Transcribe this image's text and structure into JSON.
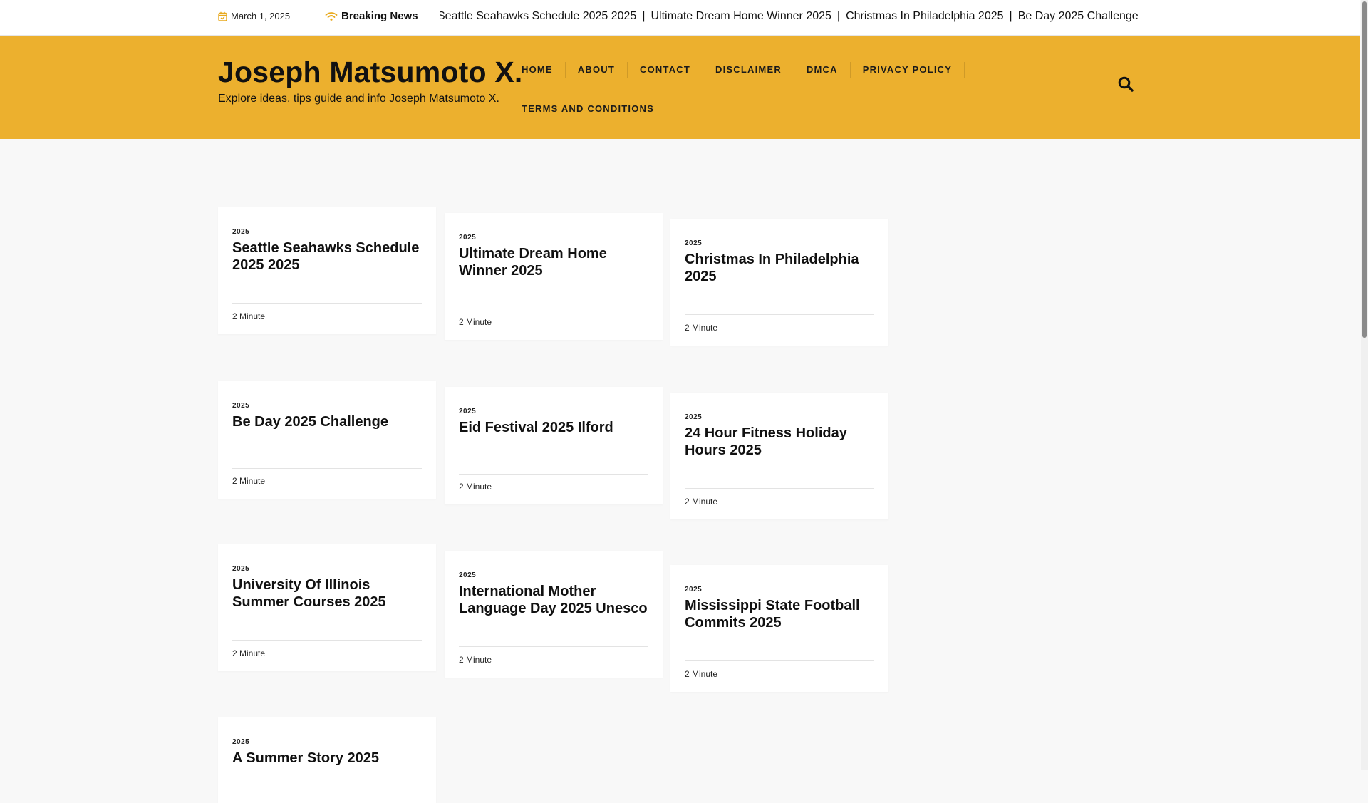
{
  "topbar": {
    "date": "March 1, 2025",
    "breaking_label": "Breaking News",
    "ticker": [
      "Seattle Seahawks Schedule 2025 2025",
      "Ultimate Dream Home Winner 2025",
      "Christmas In Philadelphia 2025",
      "Be Day 2025 Challenge",
      "Eid Festival 2025 Ilford"
    ],
    "ticker_separator": "|"
  },
  "header": {
    "site_title": "Joseph Matsumoto X.",
    "tagline": "Explore ideas, tips guide and info Joseph Matsumoto X."
  },
  "nav": {
    "items": [
      "HOME",
      "ABOUT",
      "CONTACT",
      "DISCLAIMER",
      "DMCA",
      "PRIVACY POLICY",
      "TERMS AND CONDITIONS"
    ]
  },
  "posts": [
    {
      "category": "2025",
      "title": "Seattle Seahawks Schedule 2025 2025",
      "read_time": "2 Minute"
    },
    {
      "category": "2025",
      "title": "Ultimate Dream Home Winner 2025",
      "read_time": "2 Minute"
    },
    {
      "category": "2025",
      "title": "Christmas In Philadelphia 2025",
      "read_time": "2 Minute"
    },
    {
      "category": "2025",
      "title": "Be Day 2025 Challenge",
      "read_time": "2 Minute"
    },
    {
      "category": "2025",
      "title": "Eid Festival 2025 Ilford",
      "read_time": "2 Minute"
    },
    {
      "category": "2025",
      "title": "24 Hour Fitness Holiday Hours 2025",
      "read_time": "2 Minute"
    },
    {
      "category": "2025",
      "title": "University Of Illinois Summer Courses 2025",
      "read_time": "2 Minute"
    },
    {
      "category": "2025",
      "title": "International Mother Language Day 2025 Unesco",
      "read_time": "2 Minute"
    },
    {
      "category": "2025",
      "title": "Mississippi State Football Commits 2025",
      "read_time": "2 Minute"
    },
    {
      "category": "2025",
      "title": "A Summer Story 2025",
      "read_time": ""
    }
  ],
  "colors": {
    "header_bg": "#ecb02e",
    "accent": "#e8a91c",
    "page_bg": "#f8f8f8"
  }
}
